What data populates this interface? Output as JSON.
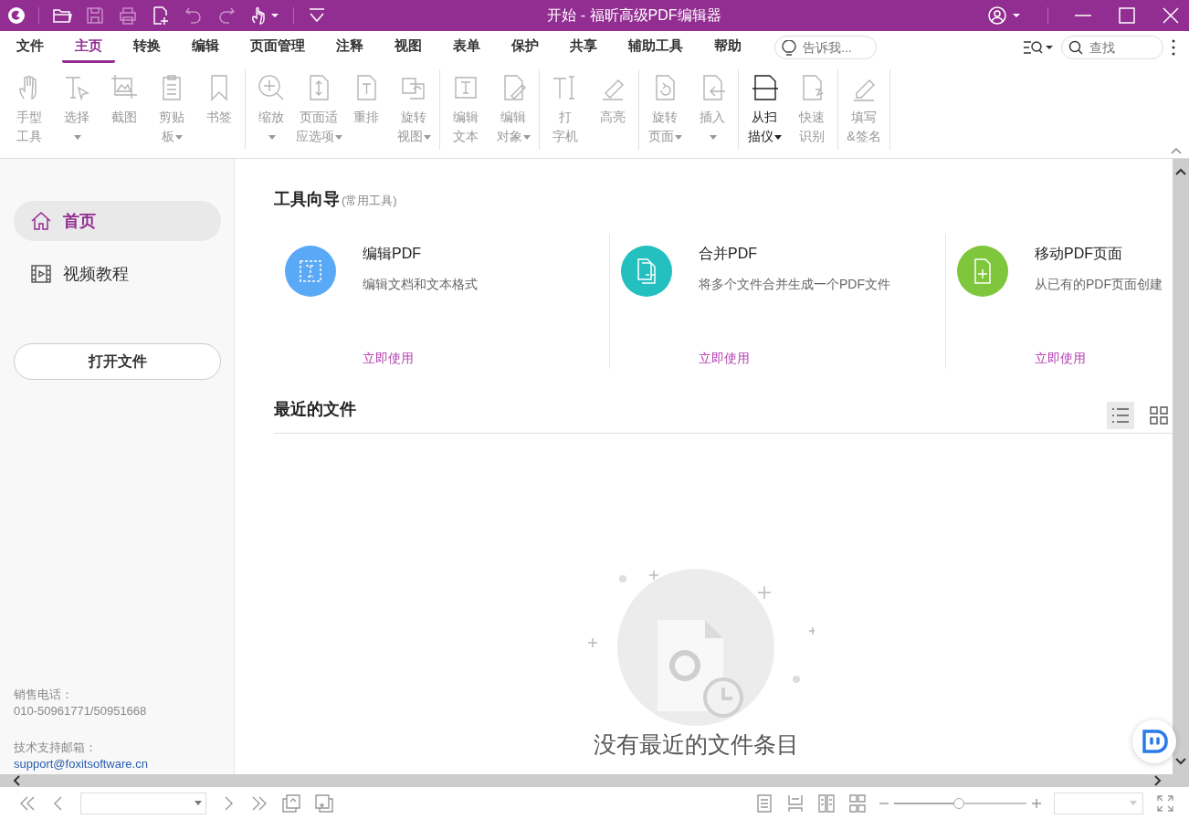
{
  "window": {
    "title": "开始 - 福昕高级PDF编辑器"
  },
  "menu_tabs": [
    {
      "label": "文件",
      "selected": false
    },
    {
      "label": "主页",
      "selected": true
    },
    {
      "label": "转换",
      "selected": false
    },
    {
      "label": "编辑",
      "selected": false
    },
    {
      "label": "页面管理",
      "selected": false
    },
    {
      "label": "注释",
      "selected": false
    },
    {
      "label": "视图",
      "selected": false
    },
    {
      "label": "表单",
      "selected": false
    },
    {
      "label": "保护",
      "selected": false
    },
    {
      "label": "共享",
      "selected": false
    },
    {
      "label": "辅助工具",
      "selected": false
    },
    {
      "label": "帮助",
      "selected": false
    }
  ],
  "tell_me": {
    "placeholder": "告诉我..."
  },
  "find": {
    "placeholder": "查找"
  },
  "ribbon": {
    "groups": [
      {
        "tools": [
          {
            "lines": [
              "手型",
              "工具"
            ],
            "dropdown": false,
            "disabled": true
          },
          {
            "lines": [
              "选择"
            ],
            "dropdown": true,
            "disabled": true
          },
          {
            "lines": [
              "截图"
            ],
            "dropdown": false,
            "disabled": true
          },
          {
            "lines": [
              "剪贴",
              "板"
            ],
            "dropdown": true,
            "disabled": true
          },
          {
            "lines": [
              "书签"
            ],
            "dropdown": false,
            "disabled": true
          }
        ]
      },
      {
        "tools": [
          {
            "lines": [
              "缩放"
            ],
            "dropdown": true,
            "disabled": true
          },
          {
            "lines": [
              "页面适",
              "应选项"
            ],
            "dropdown": true,
            "disabled": true
          },
          {
            "lines": [
              "重排"
            ],
            "dropdown": false,
            "disabled": true
          },
          {
            "lines": [
              "旋转",
              "视图"
            ],
            "dropdown": true,
            "disabled": true
          }
        ]
      },
      {
        "tools": [
          {
            "lines": [
              "编辑",
              "文本"
            ],
            "dropdown": false,
            "disabled": true
          },
          {
            "lines": [
              "编辑",
              "对象"
            ],
            "dropdown": true,
            "disabled": true
          }
        ]
      },
      {
        "tools": [
          {
            "lines": [
              "打",
              "字机"
            ],
            "dropdown": false,
            "disabled": true
          },
          {
            "lines": [
              "高亮"
            ],
            "dropdown": false,
            "disabled": true
          }
        ]
      },
      {
        "tools": [
          {
            "lines": [
              "旋转",
              "页面"
            ],
            "dropdown": true,
            "disabled": true
          },
          {
            "lines": [
              "插入"
            ],
            "dropdown": true,
            "disabled": true
          }
        ]
      },
      {
        "tools": [
          {
            "lines": [
              "从扫",
              "描仪"
            ],
            "dropdown": true,
            "disabled": false
          },
          {
            "lines": [
              "快速",
              "识别"
            ],
            "dropdown": false,
            "disabled": true
          }
        ]
      },
      {
        "tools": [
          {
            "lines": [
              "填写",
              "&签名"
            ],
            "dropdown": false,
            "disabled": true
          }
        ]
      }
    ]
  },
  "sidebar": {
    "items": [
      {
        "label": "首页",
        "selected": true
      },
      {
        "label": "视频教程",
        "selected": false
      }
    ],
    "open_button": "打开文件",
    "contacts": [
      {
        "label": "销售电话：",
        "value": "010-50961771/50951668",
        "kind": "text"
      },
      {
        "label": "技术支持邮箱：",
        "value": "support@foxitsoftware.cn",
        "kind": "link"
      }
    ]
  },
  "tool_guide": {
    "title": "工具向导",
    "subtitle": "(常用工具)",
    "cards": [
      {
        "title": "编辑PDF",
        "description": "编辑文档和文本格式",
        "link": "立即使用",
        "color": "#5aa9f7"
      },
      {
        "title": "合并PDF",
        "description": "将多个文件合并生成一个PDF文件",
        "link": "立即使用",
        "color": "#24bfbf"
      },
      {
        "title": "移动PDF页面",
        "description": "从已有的PDF页面创建",
        "link": "立即使用",
        "color": "#7ec63b"
      }
    ]
  },
  "recent": {
    "title": "最近的文件",
    "views": [
      {
        "kind": "list",
        "selected": true
      },
      {
        "kind": "grid",
        "selected": false
      }
    ],
    "empty_text": "没有最近的文件条目"
  },
  "status_bar": {
    "zoom": {
      "level": 0.49
    }
  }
}
